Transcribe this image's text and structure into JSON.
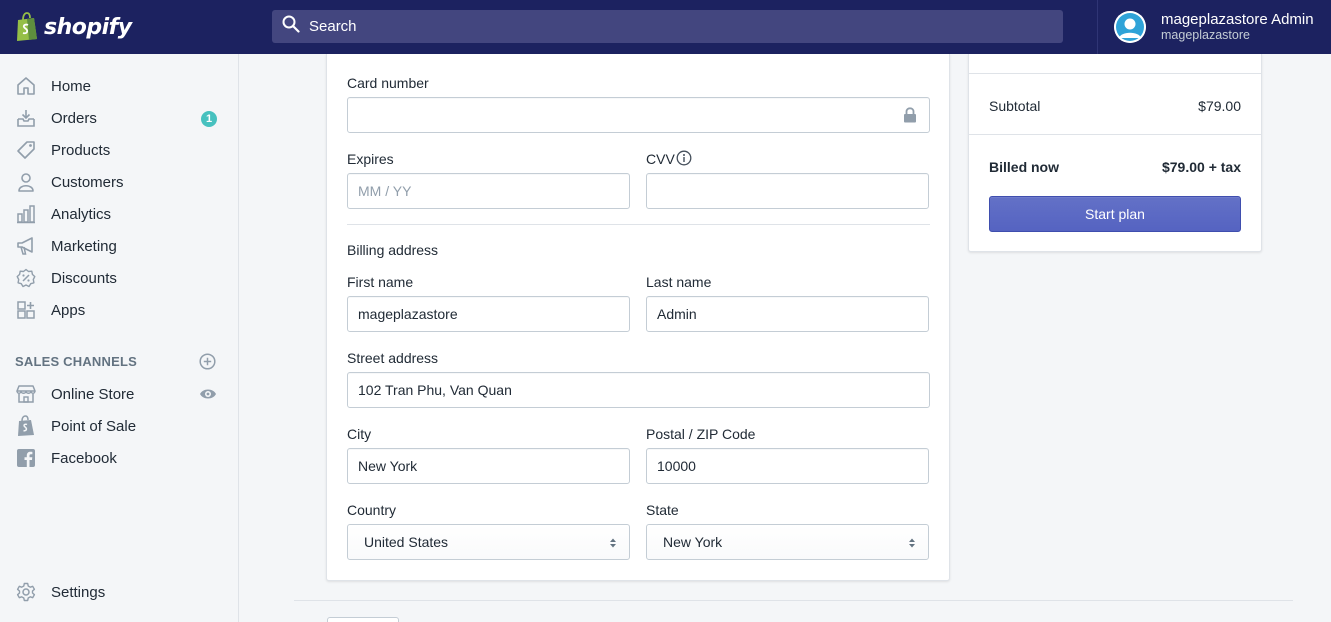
{
  "topbar": {
    "brand": "shopify",
    "search_placeholder": "Search",
    "user_name": "mageplazastore Admin",
    "user_store": "mageplazastore"
  },
  "sidebar": {
    "items": [
      {
        "label": "Home",
        "icon": "home-icon"
      },
      {
        "label": "Orders",
        "icon": "orders-icon",
        "badge": "1"
      },
      {
        "label": "Products",
        "icon": "tag-icon"
      },
      {
        "label": "Customers",
        "icon": "person-icon"
      },
      {
        "label": "Analytics",
        "icon": "bar-chart-icon"
      },
      {
        "label": "Marketing",
        "icon": "megaphone-icon"
      },
      {
        "label": "Discounts",
        "icon": "discount-icon"
      },
      {
        "label": "Apps",
        "icon": "apps-icon"
      }
    ],
    "sales_channels_heading": "SALES CHANNELS",
    "channels": [
      {
        "label": "Online Store",
        "icon": "store-icon"
      },
      {
        "label": "Point of Sale",
        "icon": "shopify-bag-icon"
      },
      {
        "label": "Facebook",
        "icon": "facebook-icon"
      }
    ],
    "settings_label": "Settings"
  },
  "form": {
    "card_number_label": "Card number",
    "card_number_value": "",
    "expires_label": "Expires",
    "expires_placeholder": "MM / YY",
    "cvv_label": "CVV",
    "cvv_value": "",
    "billing_heading": "Billing address",
    "first_name_label": "First name",
    "first_name_value": "mageplazastore",
    "last_name_label": "Last name",
    "last_name_value": "Admin",
    "street_label": "Street address",
    "street_value": "102 Tran Phu, Van Quan",
    "city_label": "City",
    "city_value": "New York",
    "zip_label": "Postal / ZIP Code",
    "zip_value": "10000",
    "country_label": "Country",
    "country_value": "United States",
    "state_label": "State",
    "state_value": "New York"
  },
  "summary": {
    "subtotal_label": "Subtotal",
    "subtotal_value": "$79.00",
    "billed_now_label": "Billed now",
    "billed_now_value": "$79.00 + tax",
    "start_plan_label": "Start plan"
  },
  "colors": {
    "topbar": "#1c2260",
    "primary_button": "#5c6ac4",
    "badge": "#47c1bf"
  }
}
